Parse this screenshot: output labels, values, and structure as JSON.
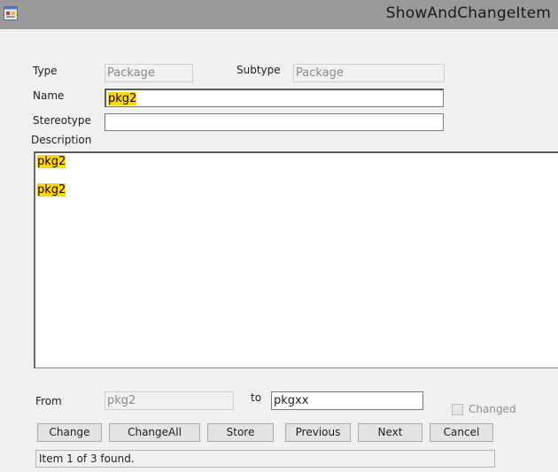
{
  "window": {
    "title": "ShowAndChangeItem",
    "icon": "app-window-icon"
  },
  "form": {
    "type_label": "Type",
    "type_value": "Package",
    "subtype_label": "Subtype",
    "subtype_value": "Package",
    "name_label": "Name",
    "name_value": "pkg2",
    "stereotype_label": "Stereotype",
    "stereotype_value": "",
    "description_label": "Description",
    "description_lines": [
      "pkg2",
      "",
      "pkg2"
    ]
  },
  "replace": {
    "from_label": "From",
    "from_value": "pkg2",
    "to_label": "to",
    "to_value": "pkgxx",
    "changed_label": "Changed",
    "changed_checked": false
  },
  "buttons": {
    "change": "Change",
    "change_all": "ChangeAll",
    "store": "Store",
    "previous": "Previous",
    "next": "Next",
    "cancel": "Cancel"
  },
  "status": {
    "text": "Item 1 of 3 found."
  },
  "colors": {
    "highlight": "#ffd800",
    "titlebar": "#9a9a9a",
    "background": "#f0f0f0"
  }
}
